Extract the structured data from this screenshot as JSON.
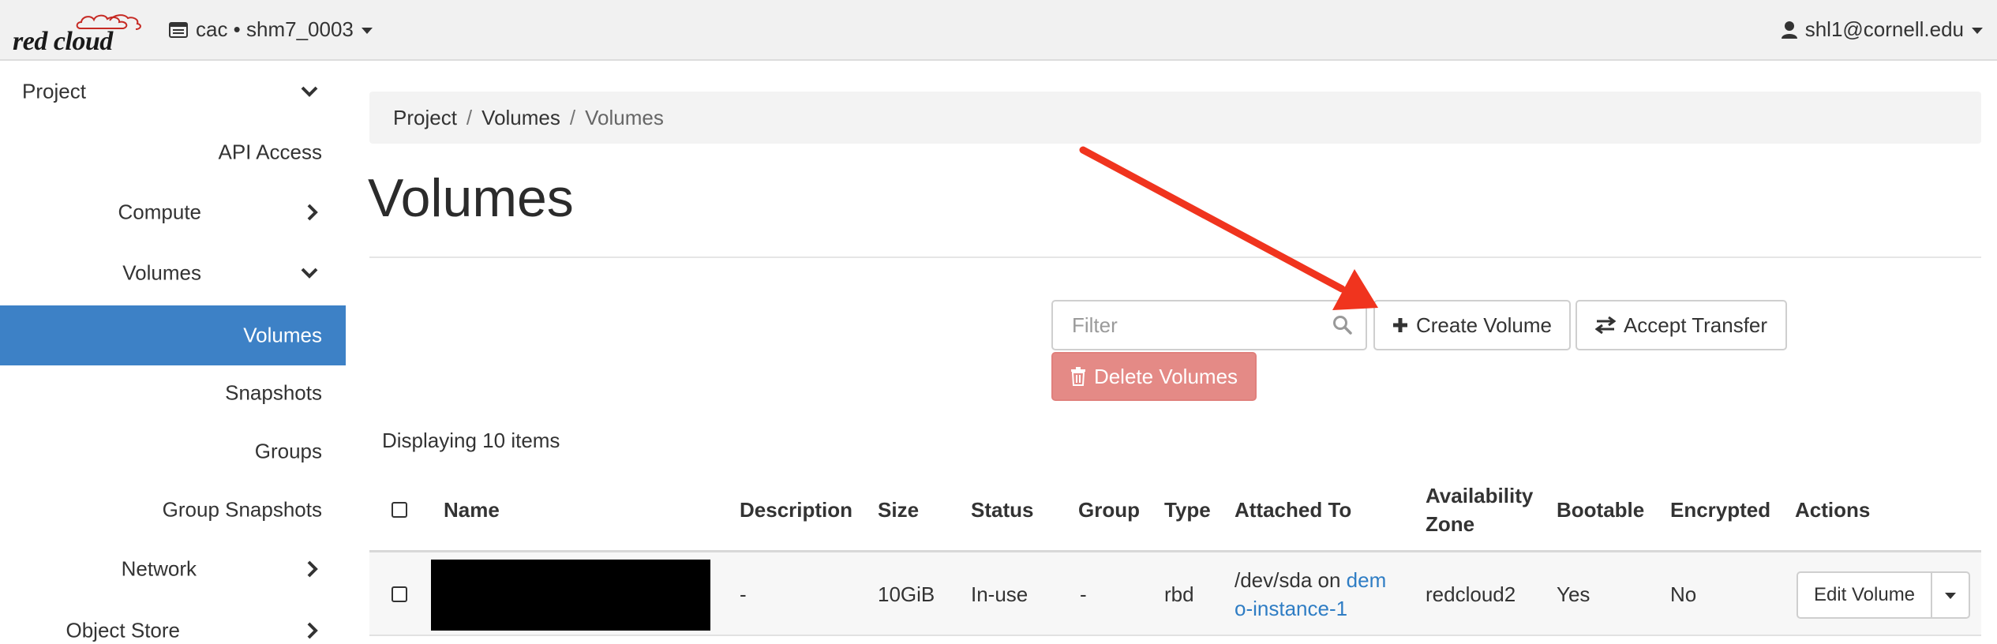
{
  "brand": {
    "logo_text": "red cloud"
  },
  "header": {
    "project_switcher": "cac • shm7_0003",
    "user": "shl1@cornell.edu"
  },
  "sidebar": {
    "items": [
      {
        "label": "Project"
      },
      {
        "label": "API Access"
      },
      {
        "label": "Compute"
      },
      {
        "label": "Volumes"
      },
      {
        "label": "Volumes"
      },
      {
        "label": "Snapshots"
      },
      {
        "label": "Groups"
      },
      {
        "label": "Group Snapshots"
      },
      {
        "label": "Network"
      },
      {
        "label": "Object Store"
      }
    ]
  },
  "breadcrumb": {
    "items": [
      "Project",
      "Volumes",
      "Volumes"
    ],
    "separator": "/"
  },
  "page": {
    "title": "Volumes"
  },
  "toolbar": {
    "filter_placeholder": "Filter",
    "create_label": "Create Volume",
    "accept_label": "Accept Transfer",
    "delete_label": "Delete Volumes"
  },
  "table": {
    "count_text": "Displaying 10 items",
    "headers": [
      "Name",
      "Description",
      "Size",
      "Status",
      "Group",
      "Type",
      "Attached To",
      "Availability Zone",
      "Bootable",
      "Encrypted",
      "Actions"
    ],
    "rows": [
      {
        "name": "",
        "description": "-",
        "size": "10GiB",
        "status": "In-use",
        "group": "-",
        "type": "rbd",
        "attached_prefix": "/dev/sda on",
        "attached_link_a": "dem",
        "attached_link_b": "o-instance-1",
        "zone": "redcloud2",
        "bootable": "Yes",
        "encrypted": "No",
        "action": "Edit Volume"
      }
    ]
  },
  "colors": {
    "active_nav": "#3d81c6",
    "delete_button": "#e48a86",
    "link": "#2f7dc4",
    "annotation_arrow": "#f0341e"
  }
}
